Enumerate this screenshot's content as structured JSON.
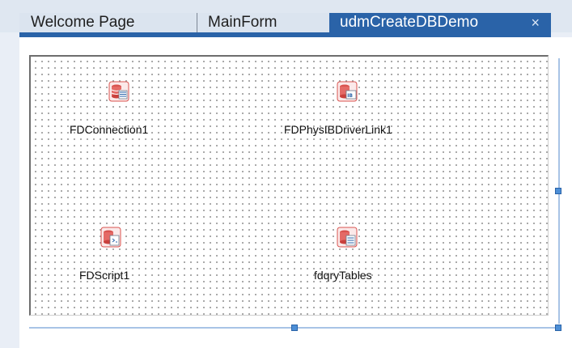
{
  "tabs": [
    {
      "label": "Welcome Page"
    },
    {
      "label": "MainForm"
    },
    {
      "label": "udmCreateDBDemo",
      "active": true,
      "close": "×"
    }
  ],
  "components": [
    {
      "name": "FDConnection1",
      "icon": "database-connection-icon"
    },
    {
      "name": "FDPhysIBDriverLink1",
      "icon": "ib-driver-link-icon"
    },
    {
      "name": "FDScript1",
      "icon": "database-script-icon"
    },
    {
      "name": "fdqryTables",
      "icon": "database-query-icon"
    }
  ],
  "colors": {
    "active_tab": "#2a63a8",
    "db_icon": "#d9534f",
    "grid_dots": "#9a9a9a",
    "resize_handle": "#4c8ed6"
  }
}
